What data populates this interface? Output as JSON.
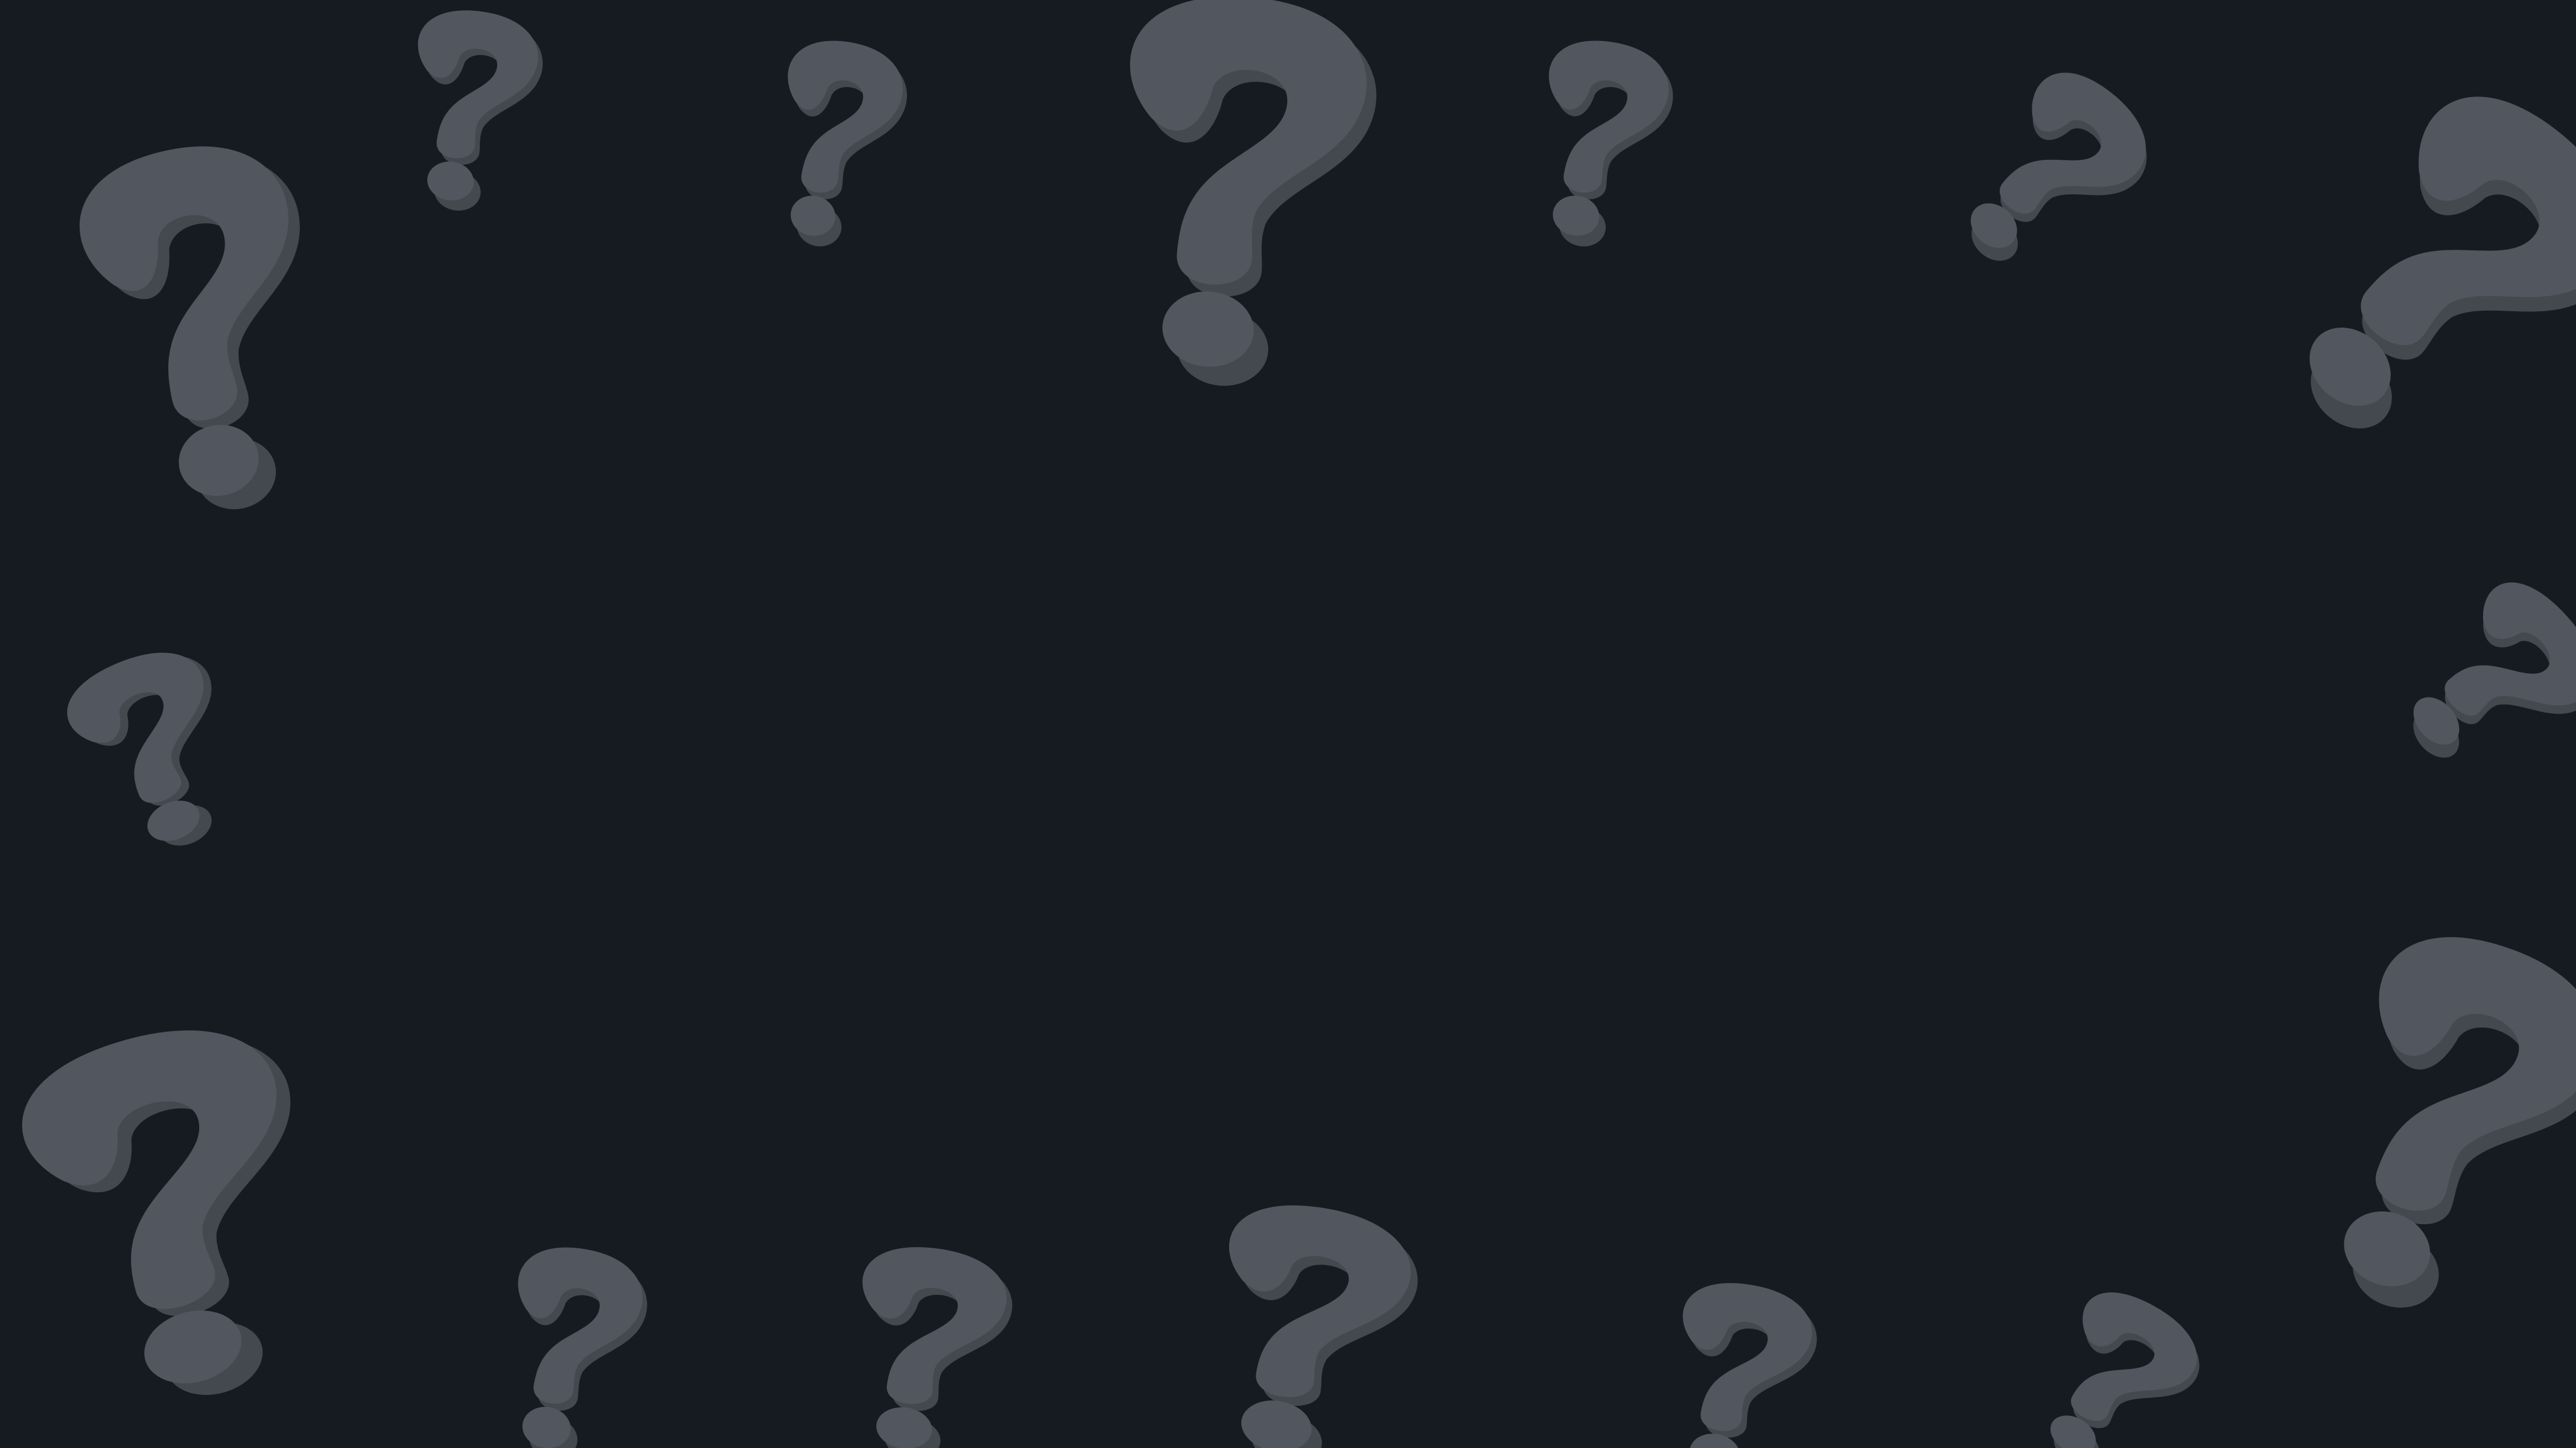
{
  "background_color": "#161a21",
  "mark_color": "#52575f",
  "mark_shadow_color": "#444950",
  "icon": "question-mark-icon",
  "marks": [
    {
      "name": "question-mark-icon-top-left-large"
    },
    {
      "name": "question-mark-icon-top-small-1"
    },
    {
      "name": "question-mark-icon-top-small-2"
    },
    {
      "name": "question-mark-icon-top-center-large"
    },
    {
      "name": "question-mark-icon-top-small-3"
    },
    {
      "name": "question-mark-icon-top-small-4"
    },
    {
      "name": "question-mark-icon-top-right-large"
    },
    {
      "name": "question-mark-icon-left-middle"
    },
    {
      "name": "question-mark-icon-right-middle"
    },
    {
      "name": "question-mark-icon-bottom-left-large"
    },
    {
      "name": "question-mark-icon-bottom-small-1"
    },
    {
      "name": "question-mark-icon-bottom-small-2"
    },
    {
      "name": "question-mark-icon-bottom-center"
    },
    {
      "name": "question-mark-icon-bottom-small-3"
    },
    {
      "name": "question-mark-icon-bottom-small-4"
    },
    {
      "name": "question-mark-icon-bottom-right-large"
    }
  ]
}
